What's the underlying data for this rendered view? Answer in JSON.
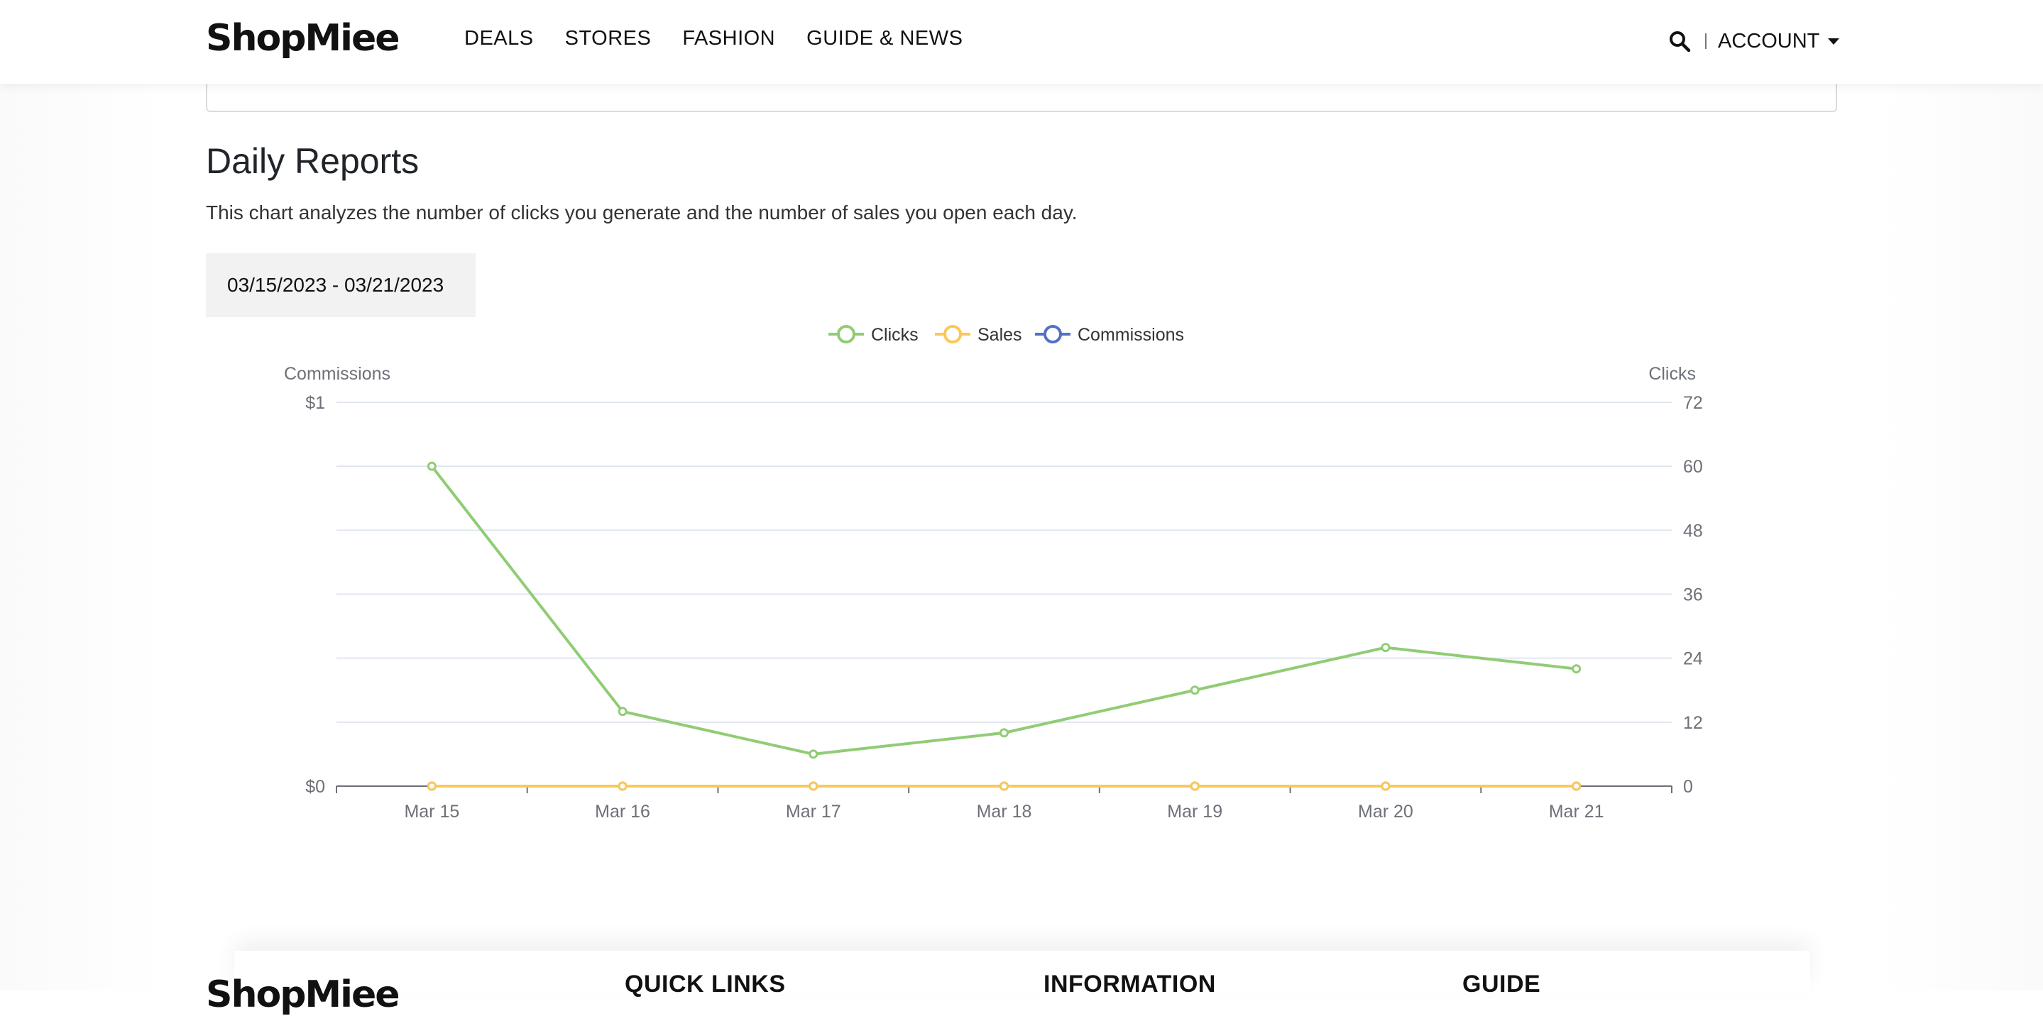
{
  "header": {
    "logo": "ShopMiee",
    "nav": [
      "DEALS",
      "STORES",
      "FASHION",
      "GUIDE & NEWS"
    ],
    "search_icon": "search-icon",
    "account_label": "ACCOUNT"
  },
  "report": {
    "title": "Daily Reports",
    "description": "This chart analyzes the number of clicks you generate and the number of sales you open each day.",
    "date_range": "03/15/2023 - 03/21/2023"
  },
  "chart_data": {
    "type": "line",
    "categories": [
      "Mar 15",
      "Mar 16",
      "Mar 17",
      "Mar 18",
      "Mar 19",
      "Mar 20",
      "Mar 21"
    ],
    "series": [
      {
        "name": "Clicks",
        "axis": "right",
        "color": "#91cc75",
        "values": [
          60,
          14,
          6,
          10,
          18,
          26,
          22
        ]
      },
      {
        "name": "Sales",
        "axis": "right",
        "color": "#fac858",
        "values": [
          0,
          0,
          0,
          0,
          0,
          0,
          0
        ]
      },
      {
        "name": "Commissions",
        "axis": "left",
        "color": "#5470c6",
        "values": [
          0,
          0,
          0,
          0,
          0,
          0,
          0
        ]
      }
    ],
    "legend": [
      "Clicks",
      "Sales",
      "Commissions"
    ],
    "legend_position": "top-center",
    "y_left": {
      "label": "Commissions",
      "ticks": [
        "$0",
        "$1"
      ],
      "range": [
        0,
        1
      ]
    },
    "y_right": {
      "label": "Clicks",
      "ticks": [
        "0",
        "12",
        "24",
        "36",
        "48",
        "60",
        "72"
      ],
      "range": [
        0,
        72
      ]
    },
    "grid": true
  },
  "footer": {
    "logo": "ShopMiee",
    "headings": [
      "QUICK LINKS",
      "INFORMATION",
      "GUIDE"
    ]
  }
}
